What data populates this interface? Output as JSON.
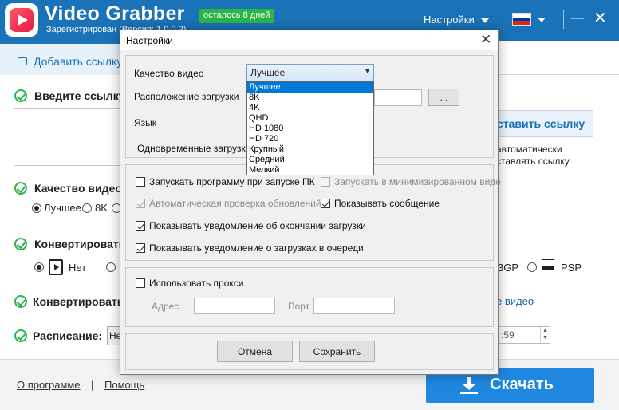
{
  "app": {
    "title": "Video Grabber",
    "trial_badge": "осталось 8 дней",
    "registered_text": "Зарегистрирован (Версия: 1.0.0.2)",
    "settings_menu": "Настройки",
    "flag_colors": [
      "#ffffff",
      "#0039a6",
      "#d52b1e"
    ]
  },
  "tab": {
    "add_link": "Добавить ссылку"
  },
  "main": {
    "enter_link_label": "Введите ссылку",
    "paste_button": "ставить ссылку",
    "auto_paste_line1": "автоматически",
    "auto_paste_line2": "ставлять ссылку",
    "quality_label": "Качество видео:",
    "quality_opt_best": "Лучшее",
    "quality_opt_8k": "8K",
    "convert_label": "Конвертировать",
    "convert_opt_none": "Нет",
    "format_3gp": "3GP",
    "format_psp": "PSP",
    "convert2_label": "Конвертировать",
    "convert_link": "е видео",
    "schedule_label": "Расписание:",
    "schedule_value": "Не",
    "time_value": ":59"
  },
  "footer": {
    "about_link": "О программе",
    "separator": "|",
    "help_link": "Помощь",
    "download_button": "Скачать"
  },
  "dialog": {
    "title": "Настройки",
    "quality_label": "Качество видео",
    "quality_selected": "Лучшее",
    "quality_options": [
      "Лучшее",
      "8K",
      "4K",
      "QHD",
      "HD 1080",
      "HD 720",
      "Крупный",
      "Средний",
      "Мелкий"
    ],
    "location_label": "Расположение загрузки",
    "browse_button": "...",
    "language_label": "Язык",
    "concurrent_label": "Одновременные загрузки",
    "start_with_pc": "Запускать программу при запуске ПК",
    "start_minimized": "Запускать в минимизированном виде",
    "auto_update": "Автоматическая проверка обновлений",
    "show_message": "Показывать сообщение",
    "notify_finish": "Показывать уведомление об окончании загрузки",
    "notify_queue": "Показывать уведомление о загрузках в очереди",
    "use_proxy": "Использовать прокси",
    "address_label": "Адрес",
    "port_label": "Порт",
    "cancel_button": "Отмена",
    "save_button": "Сохранить"
  }
}
